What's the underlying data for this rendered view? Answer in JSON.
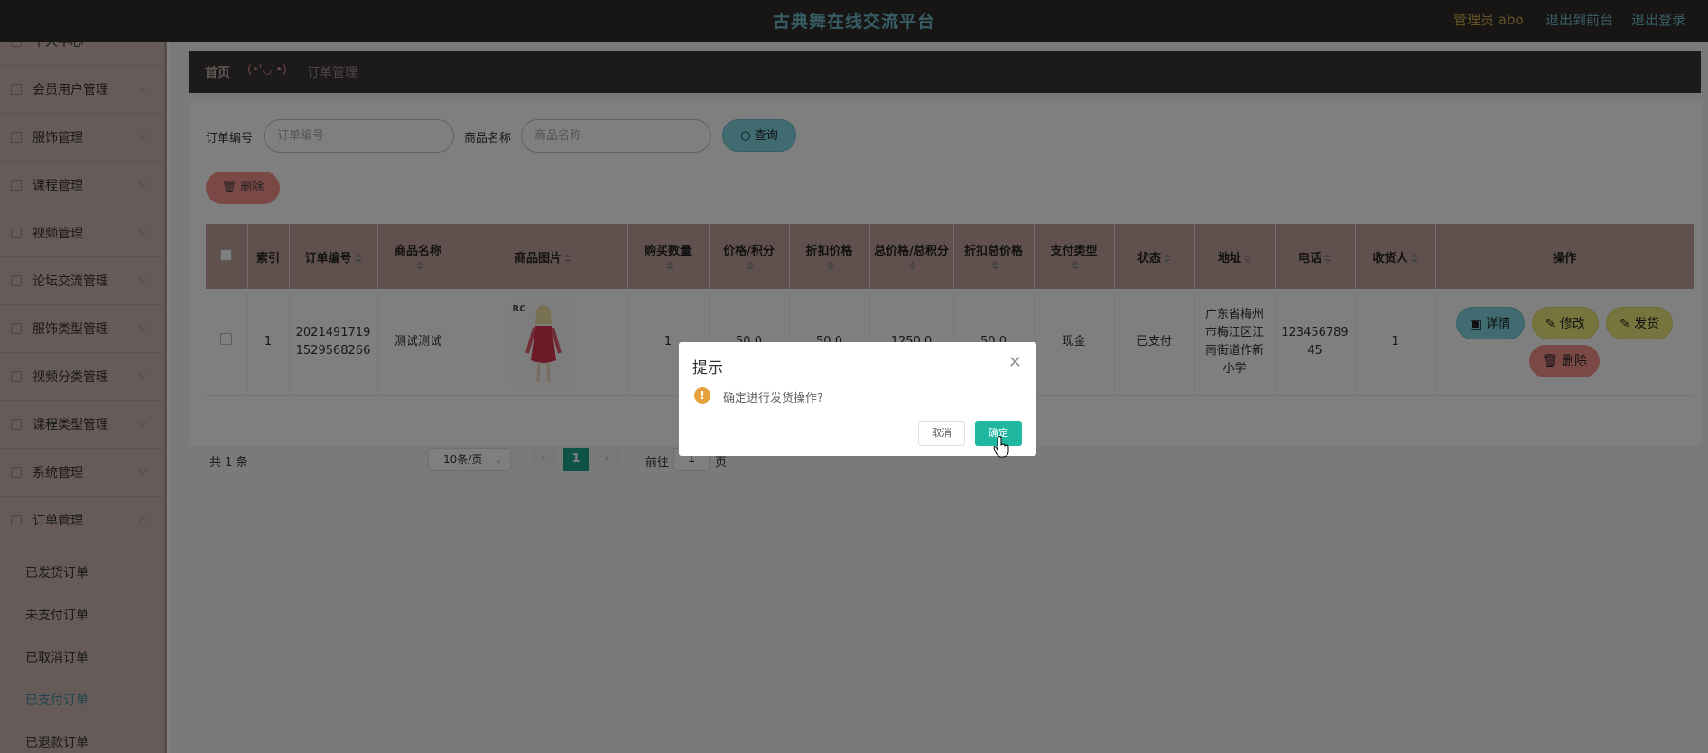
{
  "header": {
    "title": "古典舞在线交流平台",
    "admin_label": "管理员 abo",
    "front_link": "退出到前台",
    "logout_link": "退出登录"
  },
  "sidebar": {
    "items": [
      {
        "label": "个人中心"
      },
      {
        "label": "会员用户管理"
      },
      {
        "label": "服饰管理"
      },
      {
        "label": "课程管理"
      },
      {
        "label": "视频管理"
      },
      {
        "label": "论坛交流管理"
      },
      {
        "label": "服饰类型管理"
      },
      {
        "label": "视频分类管理"
      },
      {
        "label": "课程类型管理"
      },
      {
        "label": "系统管理"
      },
      {
        "label": "订单管理"
      }
    ],
    "sub_items": [
      {
        "label": "已发货订单"
      },
      {
        "label": "未支付订单"
      },
      {
        "label": "已取消订单"
      },
      {
        "label": "已支付订单"
      },
      {
        "label": "已退款订单"
      }
    ]
  },
  "breadcrumb": {
    "home": "首页",
    "emoji": "(•'◡'•)",
    "current": "订单管理"
  },
  "search": {
    "order_no_label": "订单编号",
    "order_no_placeholder": "订单编号",
    "product_label": "商品名称",
    "product_placeholder": "商品名称",
    "query_label": "查询",
    "delete_label": "删除"
  },
  "table": {
    "headers": [
      "索引",
      "订单编号",
      "商品名称",
      "商品图片",
      "购买数量",
      "价格/积分",
      "折扣价格",
      "总价格/总积分",
      "折扣总价格",
      "支付类型",
      "状态",
      "地址",
      "电话",
      "收货人",
      "操作"
    ],
    "rows": [
      {
        "index": "1",
        "order_no": "20214917191529568266",
        "product": "测试测试",
        "image_tag": "RC",
        "quantity": "1",
        "price": "50.0",
        "discount_price": "50.0",
        "total": "1250.0",
        "discount_total": "50.0",
        "pay_type": "现金",
        "status": "已支付",
        "address": "广东省梅州市梅江区江南街道作新小学",
        "phone": "12345678945",
        "receiver": "1"
      }
    ],
    "actions": {
      "detail": "详情",
      "edit": "修改",
      "ship": "发货",
      "delete": "删除"
    }
  },
  "pagination": {
    "total": "共 1 条",
    "page_size": "10条/页",
    "current_page": "1",
    "goto_label": "前往",
    "goto_value": "1",
    "page_suffix": "页"
  },
  "dialog": {
    "title": "提示",
    "message": "确定进行发货操作?",
    "cancel": "取消",
    "confirm": "确定"
  },
  "colors": {
    "topbar": "#2f2d2b",
    "sidebar": "#cdb7b1",
    "table_header": "#c3a29d",
    "confirm": "#20b7a0",
    "warning": "#e6a23c"
  }
}
